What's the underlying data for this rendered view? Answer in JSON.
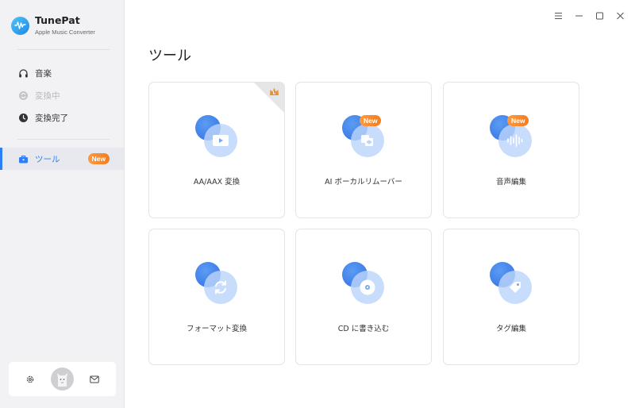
{
  "app": {
    "name": "TunePat",
    "subtitle": "Apple Music Converter"
  },
  "sidebar": {
    "items": [
      {
        "label": "音楽",
        "icon": "headphones-icon",
        "state": "normal"
      },
      {
        "label": "変換中",
        "icon": "converting-icon",
        "state": "disabled"
      },
      {
        "label": "変換完了",
        "icon": "clock-icon",
        "state": "normal"
      },
      {
        "label": "ツール",
        "icon": "toolbox-icon",
        "state": "active",
        "badge": "New"
      }
    ]
  },
  "bottom": {
    "settings_icon": "gear-icon",
    "avatar": "avatar",
    "mail_icon": "mail-icon"
  },
  "window": {
    "controls": [
      "menu-icon",
      "minimize-icon",
      "maximize-icon",
      "close-icon"
    ]
  },
  "main": {
    "title": "ツール",
    "tools": [
      {
        "label": "AA/AAX 変換",
        "icon": "video-play-icon",
        "badge": null,
        "corner": true
      },
      {
        "label": "AI ボーカルリムーバー",
        "icon": "vocal-remover-icon",
        "badge": "New"
      },
      {
        "label": "音声編集",
        "icon": "waveform-icon",
        "badge": "New"
      },
      {
        "label": "フォーマット変換",
        "icon": "refresh-icon",
        "badge": null
      },
      {
        "label": "CD に書き込む",
        "icon": "disc-icon",
        "badge": null
      },
      {
        "label": "タグ編集",
        "icon": "tag-icon",
        "badge": null
      }
    ]
  },
  "colors": {
    "accent": "#2f7ef5",
    "badge": "#f57c20",
    "sidebar_bg": "#f2f2f4"
  }
}
